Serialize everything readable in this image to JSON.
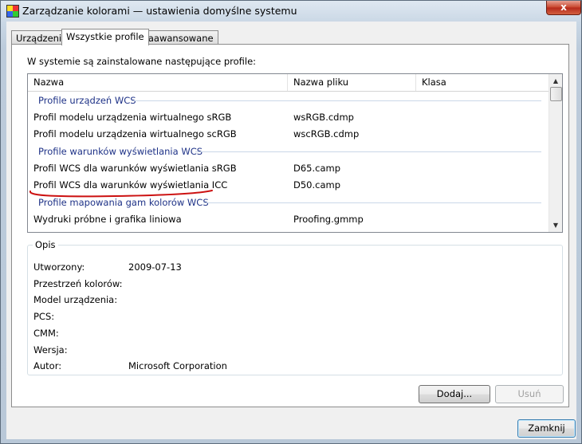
{
  "window": {
    "title": "Zarządzanie kolorami — ustawienia domyślne systemu",
    "close_label": "x"
  },
  "tabs": [
    {
      "label": "Urządzenia",
      "active": false
    },
    {
      "label": "Wszystkie profile",
      "active": true
    },
    {
      "label": "Zaawansowane",
      "active": false
    }
  ],
  "profiles": {
    "intro": "W systemie są zainstalowane następujące profile:",
    "columns": {
      "name": "Nazwa",
      "file": "Nazwa pliku",
      "class": "Klasa"
    },
    "groups": [
      {
        "title": "Profile urządzeń WCS",
        "rows": [
          {
            "name": "Profil modelu urządzenia wirtualnego sRGB",
            "file": "wsRGB.cdmp"
          },
          {
            "name": "Profil modelu urządzenia wirtualnego scRGB",
            "file": "wscRGB.cdmp"
          }
        ]
      },
      {
        "title": "Profile warunków wyświetlania WCS",
        "rows": [
          {
            "name": "Profil WCS dla warunków wyświetlania sRGB",
            "file": "D65.camp"
          },
          {
            "name": "Profil WCS dla warunków wyświetlania ICC",
            "file": "D50.camp"
          }
        ]
      },
      {
        "title": "Profile mapowania gam kolorów WCS",
        "rows": [
          {
            "name": "Wydruki próbne i grafika liniowa",
            "file": "Proofing.gmmp"
          }
        ]
      }
    ]
  },
  "description": {
    "legend": "Opis",
    "fields": [
      {
        "label": "Utworzony:",
        "value": "2009-07-13"
      },
      {
        "label": "Przestrzeń kolorów:",
        "value": ""
      },
      {
        "label": "Model urządzenia:",
        "value": ""
      },
      {
        "label": "PCS:",
        "value": ""
      },
      {
        "label": "CMM:",
        "value": ""
      },
      {
        "label": "Wersja:",
        "value": ""
      },
      {
        "label": "Autor:",
        "value": "Microsoft Corporation"
      }
    ]
  },
  "buttons": {
    "add": "Dodaj...",
    "remove": "Usuń",
    "close": "Zamknij"
  },
  "colors": {
    "group_header": "#1e3287",
    "annotation": "#cc1111"
  }
}
